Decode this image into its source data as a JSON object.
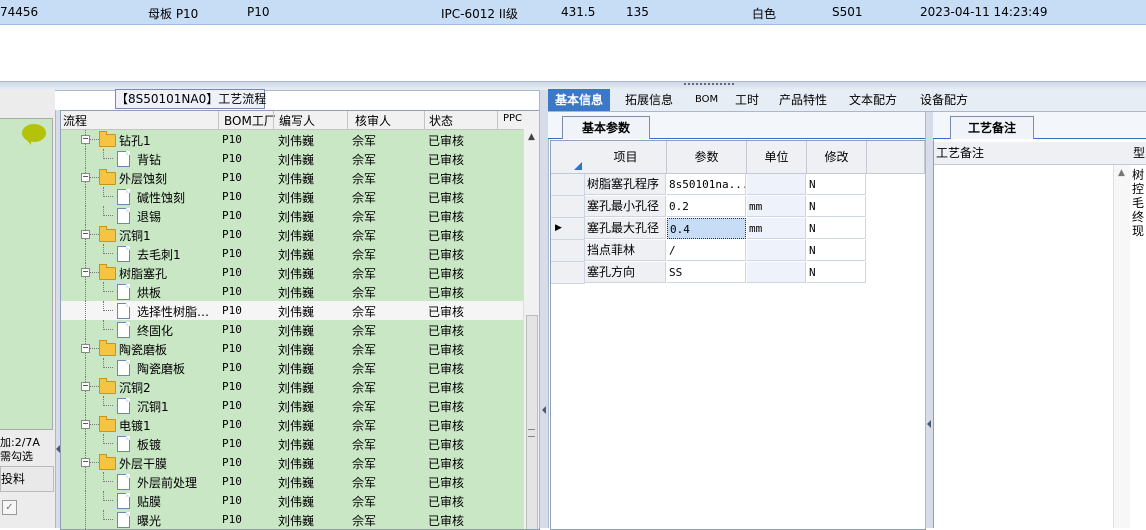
{
  "top_row": {
    "cells": [
      "74456",
      "母板 P10",
      "P10",
      "IPC-6012 II级",
      "431.5",
      "135",
      "白色",
      "S501",
      "2023-04-11 14:23:49"
    ]
  },
  "left_panel": {
    "count_text": "加:2/7A",
    "hint_text": "需勾选",
    "column_label": "投料",
    "checkbox": "✓"
  },
  "process": {
    "title": "【8S50101NA0】工艺流程",
    "columns": [
      "流程",
      "BOM工厂",
      "编写人",
      "核审人",
      "状态",
      "PPC"
    ],
    "rows": [
      {
        "level": 0,
        "name": "钻孔1",
        "factory": "P10",
        "author": "刘伟巍",
        "reviewer": "佘军",
        "status": "已审核",
        "selected": false
      },
      {
        "level": 1,
        "name": "背钻",
        "factory": "P10",
        "author": "刘伟巍",
        "reviewer": "佘军",
        "status": "已审核",
        "selected": false
      },
      {
        "level": 0,
        "name": "外层蚀刻",
        "factory": "P10",
        "author": "刘伟巍",
        "reviewer": "佘军",
        "status": "已审核",
        "selected": false
      },
      {
        "level": 1,
        "name": "碱性蚀刻",
        "factory": "P10",
        "author": "刘伟巍",
        "reviewer": "佘军",
        "status": "已审核",
        "selected": false
      },
      {
        "level": 1,
        "name": "退锡",
        "factory": "P10",
        "author": "刘伟巍",
        "reviewer": "佘军",
        "status": "已审核",
        "selected": false
      },
      {
        "level": 0,
        "name": "沉铜1",
        "factory": "P10",
        "author": "刘伟巍",
        "reviewer": "佘军",
        "status": "已审核",
        "selected": false
      },
      {
        "level": 1,
        "name": "去毛刺1",
        "factory": "P10",
        "author": "刘伟巍",
        "reviewer": "佘军",
        "status": "已审核",
        "selected": false
      },
      {
        "level": 0,
        "name": "树脂塞孔",
        "factory": "P10",
        "author": "刘伟巍",
        "reviewer": "佘军",
        "status": "已审核",
        "selected": false
      },
      {
        "level": 1,
        "name": "烘板",
        "factory": "P10",
        "author": "刘伟巍",
        "reviewer": "佘军",
        "status": "已审核",
        "selected": false
      },
      {
        "level": 1,
        "name": "选择性树脂…",
        "factory": "P10",
        "author": "刘伟巍",
        "reviewer": "佘军",
        "status": "已审核",
        "selected": true
      },
      {
        "level": 1,
        "name": "终固化",
        "factory": "P10",
        "author": "刘伟巍",
        "reviewer": "佘军",
        "status": "已审核",
        "selected": false
      },
      {
        "level": 0,
        "name": "陶瓷磨板",
        "factory": "P10",
        "author": "刘伟巍",
        "reviewer": "佘军",
        "status": "已审核",
        "selected": false
      },
      {
        "level": 1,
        "name": "陶瓷磨板",
        "factory": "P10",
        "author": "刘伟巍",
        "reviewer": "佘军",
        "status": "已审核",
        "selected": false
      },
      {
        "level": 0,
        "name": "沉铜2",
        "factory": "P10",
        "author": "刘伟巍",
        "reviewer": "佘军",
        "status": "已审核",
        "selected": false
      },
      {
        "level": 1,
        "name": "沉铜1",
        "factory": "P10",
        "author": "刘伟巍",
        "reviewer": "佘军",
        "status": "已审核",
        "selected": false
      },
      {
        "level": 0,
        "name": "电镀1",
        "factory": "P10",
        "author": "刘伟巍",
        "reviewer": "佘军",
        "status": "已审核",
        "selected": false
      },
      {
        "level": 1,
        "name": "板镀",
        "factory": "P10",
        "author": "刘伟巍",
        "reviewer": "佘军",
        "status": "已审核",
        "selected": false
      },
      {
        "level": 0,
        "name": "外层干膜",
        "factory": "P10",
        "author": "刘伟巍",
        "reviewer": "佘军",
        "status": "已审核",
        "selected": false
      },
      {
        "level": 1,
        "name": "外层前处理",
        "factory": "P10",
        "author": "刘伟巍",
        "reviewer": "佘军",
        "status": "已审核",
        "selected": false
      },
      {
        "level": 1,
        "name": "贴膜",
        "factory": "P10",
        "author": "刘伟巍",
        "reviewer": "佘军",
        "status": "已审核",
        "selected": false
      },
      {
        "level": 1,
        "name": "曝光",
        "factory": "P10",
        "author": "刘伟巍",
        "reviewer": "佘军",
        "status": "已审核",
        "selected": false
      }
    ]
  },
  "tabs": [
    "基本信息",
    "拓展信息",
    "BOM",
    "工时",
    "产品特性",
    "文本配方",
    "设备配方"
  ],
  "active_tab": 0,
  "param_tab": "基本参数",
  "params": {
    "columns": [
      "项目",
      "参数",
      "单位",
      "修改"
    ],
    "rows": [
      {
        "item": "树脂塞孔程序",
        "value": "8s50101na...",
        "unit": "",
        "modified": "N",
        "current": false
      },
      {
        "item": "塞孔最小孔径",
        "value": "0.2",
        "unit": "mm",
        "modified": "N",
        "current": false
      },
      {
        "item": "塞孔最大孔径",
        "value": "0.4",
        "unit": "mm",
        "modified": "N",
        "current": true
      },
      {
        "item": "挡点菲林",
        "value": "/",
        "unit": "",
        "modified": "N",
        "current": false
      },
      {
        "item": "塞孔方向",
        "value": "SS",
        "unit": "",
        "modified": "N",
        "current": false
      }
    ]
  },
  "notes": {
    "tab": "工艺备注",
    "column": "工艺备注",
    "column2": "型",
    "vertical_text": "树控毛终现"
  },
  "colors": {
    "selection_blue": "#c6ddf5",
    "row_green": "#c9e6c5",
    "tab_blue": "#3b78c8"
  }
}
